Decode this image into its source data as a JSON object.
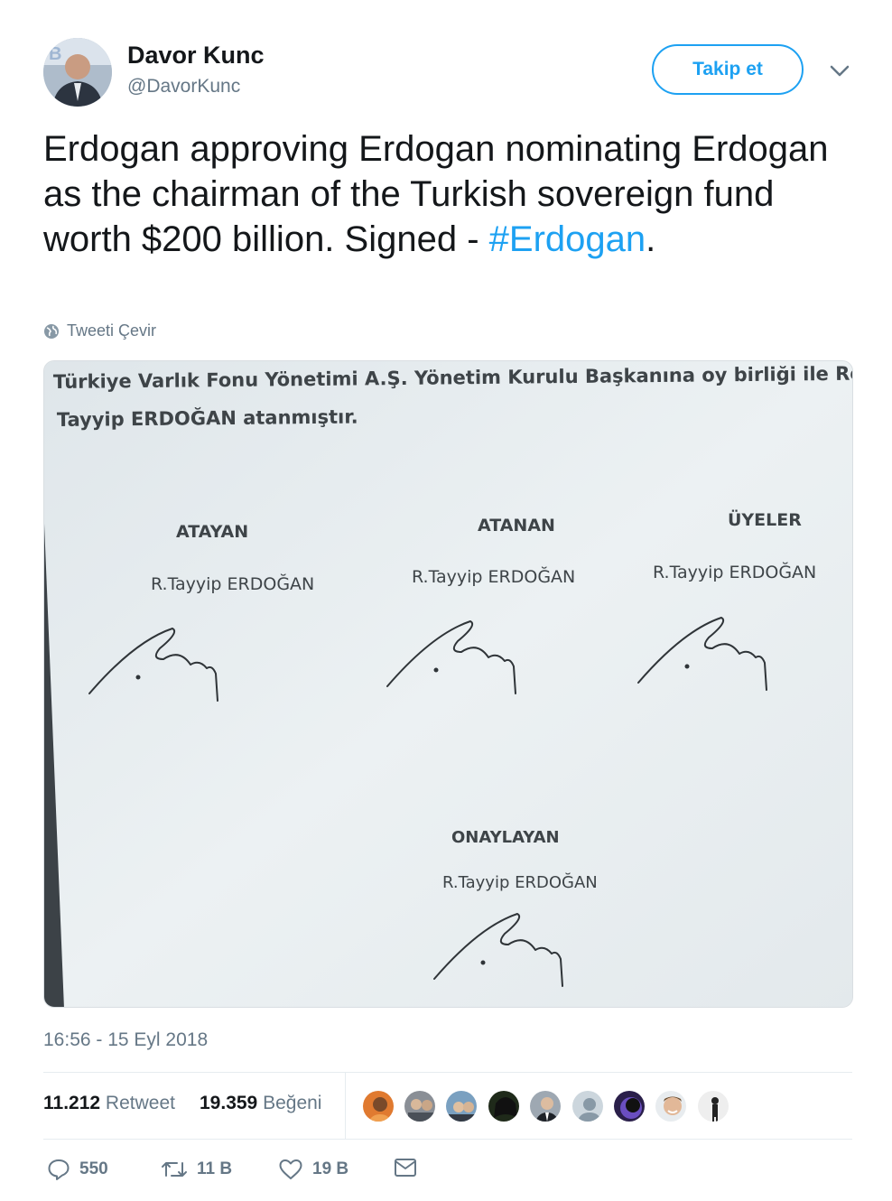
{
  "author": {
    "display_name": "Davor Kunc",
    "handle": "@DavorKunc",
    "follow_label": "Takip et"
  },
  "tweet": {
    "text_prefix": "Erdogan approving Erdogan nominating Erdogan as the chairman of the Turkish sovereign fund worth $200 billion. Signed - ",
    "hashtag": "#Erdogan",
    "text_suffix": ".",
    "translate_label": "Tweeti Çevir",
    "timestamp": "16:56 - 15 Eyl 2018"
  },
  "media": {
    "line1": "Türkiye Varlık Fonu Yönetimi A.Ş. Yönetim Kurulu Başkanına oy birliği ile Recep",
    "line2": "Tayyip ERDOĞAN atanmıştır.",
    "col1_title": "ATAYAN",
    "col2_title": "ATANAN",
    "col3_title": "ÜYELER",
    "bottom_title": "ONAYLAYAN",
    "signer_name": "R.Tayyip ERDOĞAN"
  },
  "stats": {
    "retweets_count": "11.212",
    "retweets_label": "Retweet",
    "likes_count": "19.359",
    "likes_label": "Beğeni"
  },
  "actions": {
    "reply_count": "550",
    "retweet_count": "11 B",
    "like_count": "19 B"
  },
  "colors": {
    "accent": "#1da1f2",
    "secondary_text": "#657786",
    "primary_text": "#14171a"
  },
  "icons": [
    "chevron-down-icon",
    "globe-icon",
    "reply-icon",
    "retweet-icon",
    "heart-icon",
    "envelope-icon"
  ]
}
